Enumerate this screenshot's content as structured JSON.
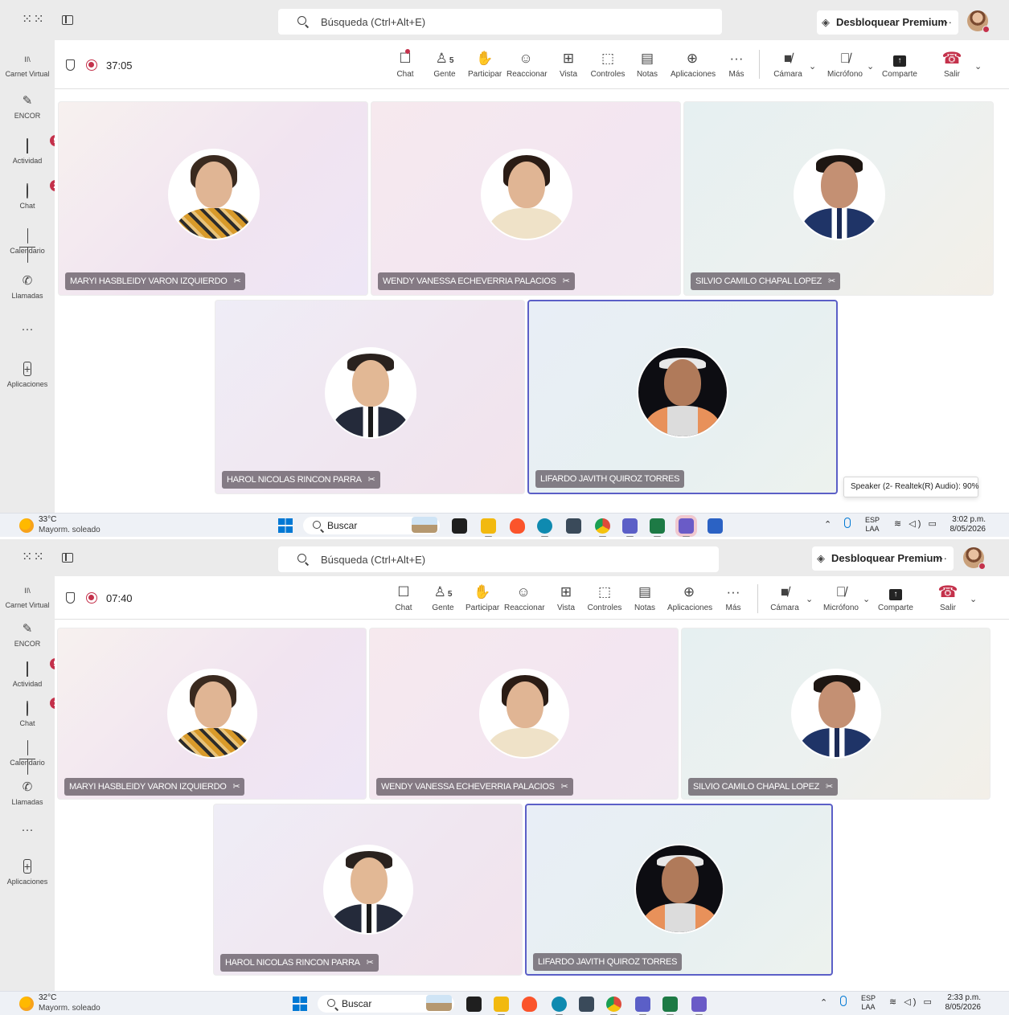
{
  "app": {
    "search_placeholder": "Búsqueda (Ctrl+Alt+E)",
    "premium_label": "Desbloquear Premium",
    "more_label": "···",
    "apps_grid_icon": "waffle-grid-icon",
    "accent_color": "#5b5fc7",
    "alert_color": "#c4314b"
  },
  "rail": {
    "items": [
      {
        "label": "Carnet Virtual",
        "icon": "carnet-icon"
      },
      {
        "label": "ENCOR",
        "icon": "app-icon"
      },
      {
        "label": "Actividad",
        "icon": "bell-icon"
      },
      {
        "label": "Chat",
        "icon": "chat-icon"
      },
      {
        "label": "Calendario",
        "icon": "calendar-icon"
      },
      {
        "label": "Llamadas",
        "icon": "phone-icon"
      },
      {
        "label": "···",
        "icon": "more-icon"
      },
      {
        "label": "Aplicaciones",
        "icon": "add-apps-icon"
      }
    ]
  },
  "toolbar": {
    "items": [
      {
        "label": "Chat",
        "icon": "chat-icon"
      },
      {
        "label": "Gente",
        "icon": "people-icon",
        "count": "5"
      },
      {
        "label": "Participar",
        "icon": "raise-hand-icon"
      },
      {
        "label": "Reaccionar",
        "icon": "emoji-icon"
      },
      {
        "label": "Vista",
        "icon": "grid-view-icon"
      },
      {
        "label": "Controles",
        "icon": "controls-icon"
      },
      {
        "label": "Notas",
        "icon": "notes-icon"
      },
      {
        "label": "Aplicaciones",
        "icon": "add-apps-icon"
      },
      {
        "label": "Más",
        "icon": "more-icon"
      },
      {
        "label": "Cámara",
        "icon": "camera-off-icon"
      },
      {
        "label": "Micrófono",
        "icon": "mic-off-icon"
      },
      {
        "label": "Comparte",
        "icon": "share-icon"
      },
      {
        "label": "Salir",
        "icon": "leave-call-icon"
      }
    ]
  },
  "participants": [
    {
      "name": "MARYI HASBLEIDY VARON IZQUIERDO",
      "muted": true
    },
    {
      "name": "WENDY VANESSA ECHEVERRIA PALACIOS",
      "muted": true
    },
    {
      "name": "SILVIO CAMILO CHAPAL LOPEZ",
      "muted": true
    },
    {
      "name": "HAROL NICOLAS RINCON PARRA",
      "muted": true
    },
    {
      "name": "LIFARDO JAVITH QUIROZ TORRES",
      "muted": false,
      "speaking": true
    }
  ],
  "screens": [
    {
      "timer": "37:05",
      "activity_badge": "5",
      "chat_badge": "2",
      "speaker_tooltip": "Speaker (2- Realtek(R) Audio): 90%",
      "taskbar": {
        "temp": "33°C",
        "weather": "Mayorm. soleado",
        "time": "3:02 p.m.",
        "date": "8/05/2026"
      }
    },
    {
      "timer": "07:40",
      "activity_badge": "5",
      "chat_badge": "1",
      "speaker_tooltip": "",
      "taskbar": {
        "temp": "32°C",
        "weather": "Mayorm. soleado",
        "time": "2:33 p.m.",
        "date": "8/05/2026"
      }
    }
  ],
  "taskbar_common": {
    "search_label": "Buscar",
    "lang_top": "ESP",
    "lang_bottom": "LAA",
    "apps": [
      {
        "icon": "photos-icon"
      },
      {
        "icon": "task-view-icon",
        "color": "#1f1f1f"
      },
      {
        "icon": "file-explorer-icon",
        "color": "#f2b90f"
      },
      {
        "icon": "brave-browser-icon",
        "color": "#fb542b"
      },
      {
        "icon": "edge-browser-icon",
        "color": "#0f8ab0"
      },
      {
        "icon": "calculator-icon",
        "color": "#3a4a5a"
      },
      {
        "icon": "chrome-browser-icon",
        "color": "#de4a3a"
      },
      {
        "icon": "teams-icon",
        "color": "#5b5fc7"
      },
      {
        "icon": "excel-icon",
        "color": "#1d7a45"
      },
      {
        "icon": "teams-alert-icon",
        "color": "#6a5bc7"
      },
      {
        "icon": "word-icon",
        "color": "#2b62c4"
      }
    ]
  }
}
